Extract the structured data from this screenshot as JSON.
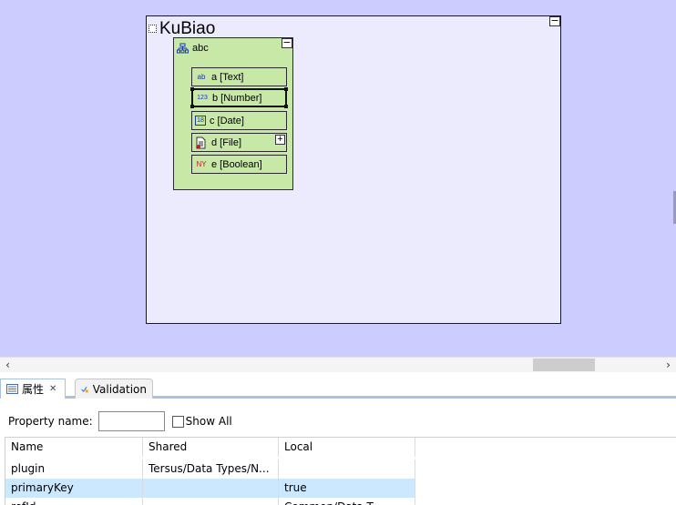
{
  "diagram": {
    "title": "KuBiao",
    "collapse_glyph": "−",
    "element": {
      "name": "abc",
      "collapse_glyph": "−",
      "fields": [
        {
          "icon_text": "ab",
          "label": "a [Text]",
          "icon_color": "#1a3aa8"
        },
        {
          "icon_text": "123",
          "label": "b [Number]",
          "icon_color": "#1a3aa8"
        },
        {
          "icon_text": "18",
          "label": "c [Date]",
          "icon_color": "#1a3aa8"
        },
        {
          "icon_text": "file",
          "label": "d [File]",
          "icon_color": "#1a3aa8",
          "expand_glyph": "+"
        },
        {
          "icon_text": "NY",
          "label": "e [Boolean]",
          "icon_color": "#c81e1e"
        }
      ]
    }
  },
  "scrollbar": {
    "left_arrow": "‹",
    "right_arrow": "›"
  },
  "views": {
    "properties_tab": {
      "label": "属性",
      "close_glyph": "✕"
    },
    "validation_tab": {
      "label": "Validation"
    }
  },
  "filter": {
    "label": "Property name:",
    "value": "",
    "show_all_label": "Show All"
  },
  "table": {
    "headers": [
      "Name",
      "Shared",
      "Local"
    ],
    "rows": [
      {
        "name": "plugin",
        "shared": "Tersus/Data Types/N...",
        "local": "",
        "selected": false
      },
      {
        "name": "primaryKey",
        "shared": "",
        "local": "true",
        "selected": true
      },
      {
        "name": "refId",
        "shared": "",
        "local": "Common/Data T...",
        "selected": false
      }
    ]
  },
  "colors": {
    "canvas_bg": "#ccccff",
    "diagram_bg": "#ebebfd",
    "element_bg": "#c8e8a8",
    "selected_row": "#cce8ff",
    "tab_accent": "#a9c2e2"
  }
}
